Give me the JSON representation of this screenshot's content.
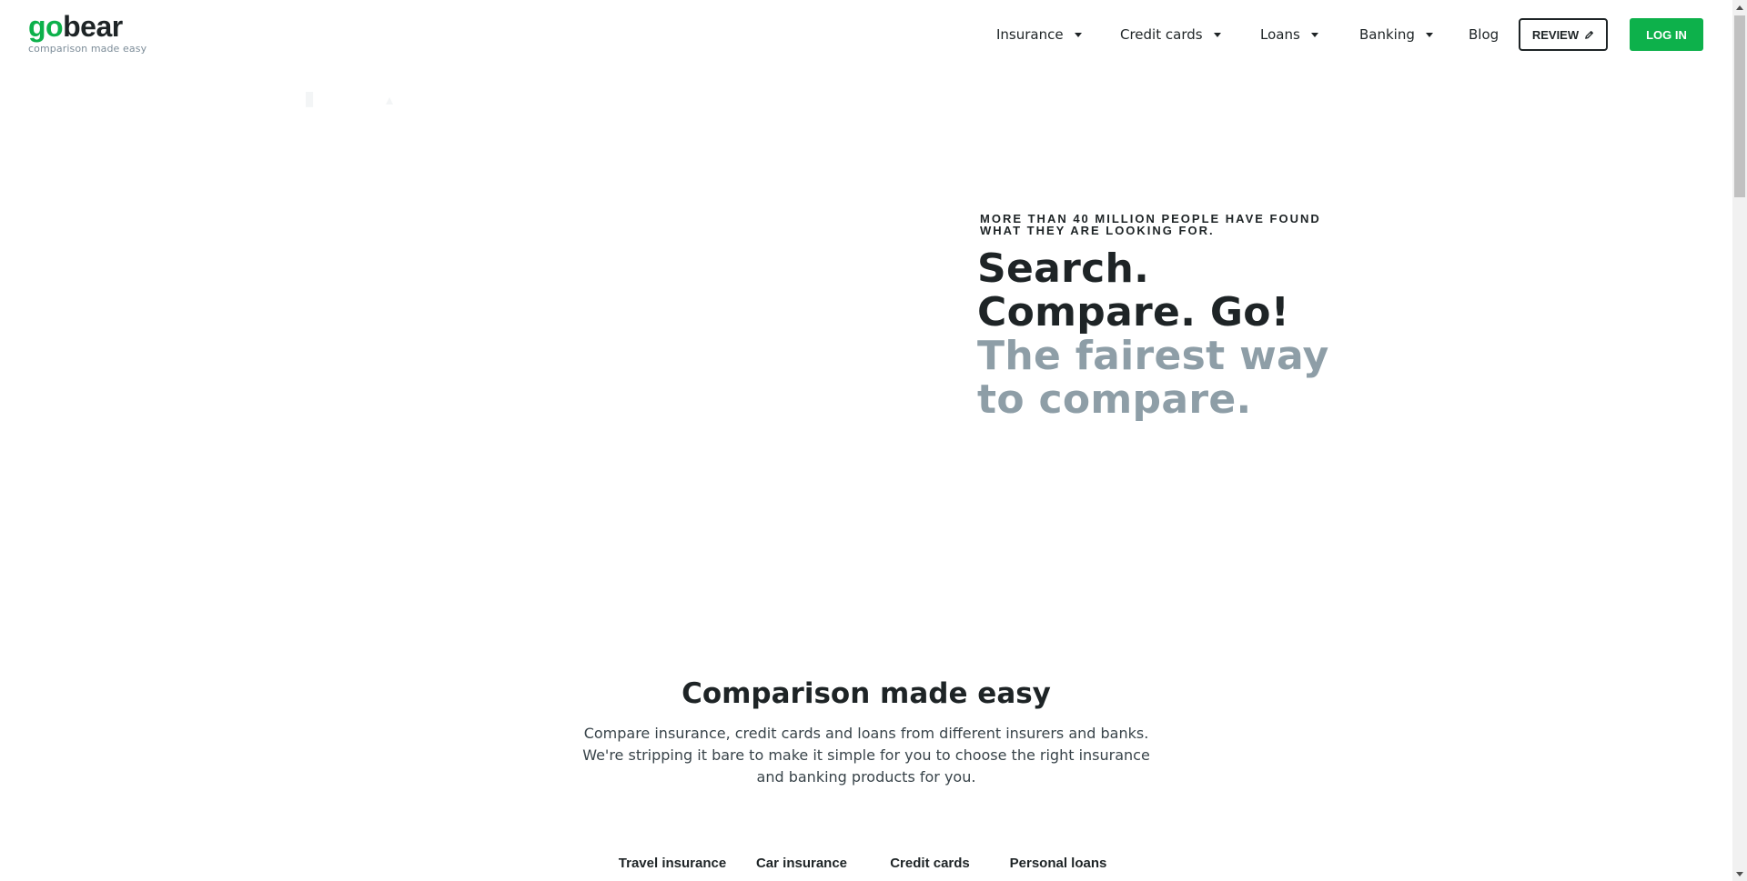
{
  "brand": {
    "logo_go": "go",
    "logo_bear": "bear",
    "tagline": "comparison made easy",
    "colors": {
      "accent": "#0db14b",
      "text_dark": "#1e2426",
      "text_muted": "#8e9ea7"
    }
  },
  "nav": {
    "items": [
      {
        "label": "Insurance",
        "dropdown": true
      },
      {
        "label": "Credit cards",
        "dropdown": true
      },
      {
        "label": "Loans",
        "dropdown": true
      },
      {
        "label": "Banking",
        "dropdown": true
      },
      {
        "label": "Blog",
        "dropdown": false
      }
    ],
    "review_label": "REVIEW",
    "review_icon": "pencil-icon",
    "login_label": "LOG IN"
  },
  "hero": {
    "kicker": "MORE THAN 40 MILLION PEOPLE HAVE FOUND WHAT THEY ARE LOOKING FOR.",
    "title_strong": "Search. Compare. Go!",
    "title_light": "The fairest way to compare."
  },
  "comparison": {
    "title": "Comparison made easy",
    "description": "Compare insurance, credit cards and loans from different insurers and banks. We're stripping it bare to make it simple for you to choose the right insurance and banking products for you.",
    "tabs": [
      {
        "label": "Travel insurance"
      },
      {
        "label": "Car insurance"
      },
      {
        "label": "Credit cards"
      },
      {
        "label": "Personal loans"
      }
    ]
  }
}
